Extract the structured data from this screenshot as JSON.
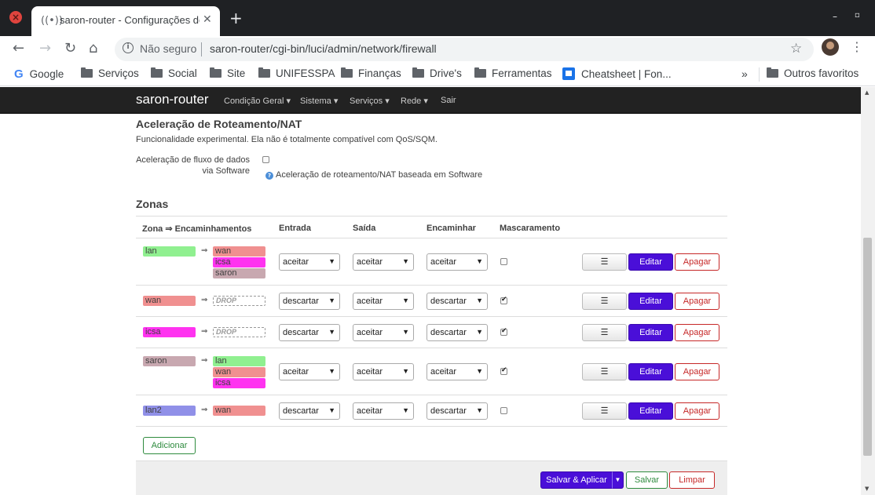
{
  "browser": {
    "tab_title": "saron-router - Configurações de",
    "url_security": "Não seguro",
    "url": "saron-router/cgi-bin/luci/admin/network/firewall",
    "bookmarks": [
      "Google",
      "Serviços",
      "Social",
      "Site",
      "UNIFESSPA",
      "Finanças",
      "Drive's",
      "Ferramentas",
      "Cheatsheet | Fon..."
    ],
    "other_bookmarks": "Outros favoritos"
  },
  "nav": {
    "brand": "saron-router",
    "menu": [
      "Condição Geral",
      "Sistema",
      "Serviços",
      "Rede",
      "Sair"
    ]
  },
  "offload": {
    "title": "Aceleração de Roteamento/NAT",
    "description": "Funcionalidade experimental. Ela não é totalmente compatível com QoS/SQM.",
    "option_label_1": "Aceleração de fluxo de dados",
    "option_label_2": "via Software",
    "option_help": "Aceleração de roteamento/NAT baseada em Software",
    "enabled": false
  },
  "zones": {
    "title": "Zonas",
    "headers": {
      "zone": "Zona ⇒ Encaminhamentos",
      "input": "Entrada",
      "output": "Saída",
      "forward": "Encaminhar",
      "masq": "Mascaramento"
    },
    "arrow": "⇒",
    "rows": [
      {
        "name": "lan",
        "color": "#90f090",
        "forwards": [
          {
            "name": "wan",
            "color": "#f09090"
          },
          {
            "name": "icsa",
            "color": "#ff33f0"
          },
          {
            "name": "saron",
            "color": "#c8a8b0"
          }
        ],
        "input": "aceitar",
        "output": "aceitar",
        "forward": "aceitar",
        "masq": false
      },
      {
        "name": "wan",
        "color": "#f09090",
        "forwards": [
          {
            "name": "DROP",
            "drop": true
          }
        ],
        "input": "descartar",
        "output": "aceitar",
        "forward": "descartar",
        "masq": true
      },
      {
        "name": "icsa",
        "color": "#ff33f0",
        "forwards": [
          {
            "name": "DROP",
            "drop": true
          }
        ],
        "input": "descartar",
        "output": "aceitar",
        "forward": "descartar",
        "masq": true
      },
      {
        "name": "saron",
        "color": "#c8a8b0",
        "forwards": [
          {
            "name": "lan",
            "color": "#90f090"
          },
          {
            "name": "wan",
            "color": "#f09090"
          },
          {
            "name": "icsa",
            "color": "#ff33f0"
          }
        ],
        "input": "aceitar",
        "output": "aceitar",
        "forward": "aceitar",
        "masq": true
      },
      {
        "name": "lan2",
        "color": "#9090e8",
        "forwards": [
          {
            "name": "wan",
            "color": "#f09090"
          }
        ],
        "input": "descartar",
        "output": "aceitar",
        "forward": "descartar",
        "masq": false
      }
    ],
    "row_buttons": {
      "menu": "☰",
      "edit": "Editar",
      "delete": "Apagar"
    },
    "add_label": "Adicionar"
  },
  "footer": {
    "save_apply": "Salvar & Aplicar",
    "save": "Salvar",
    "reset": "Limpar"
  }
}
